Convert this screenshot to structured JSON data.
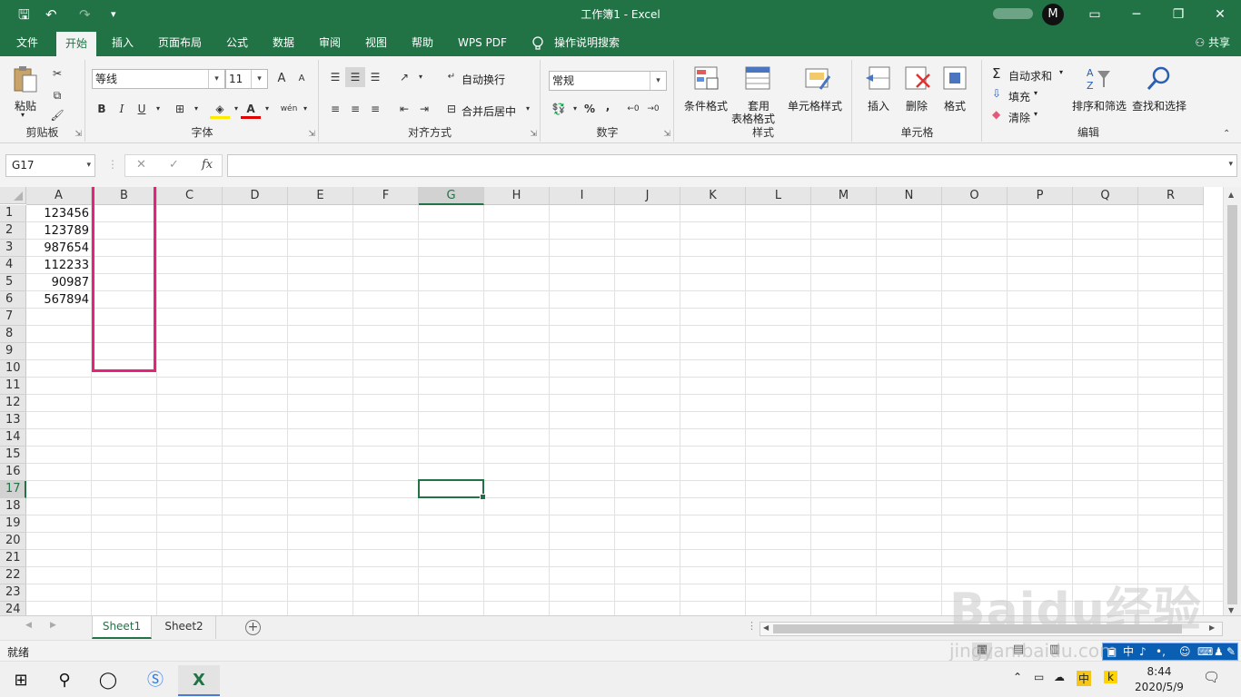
{
  "titlebar": {
    "title": "工作簿1  -  Excel",
    "avatar_initial": "M",
    "quick_access": {
      "save": "🖫",
      "undo": "↶",
      "redo": "↷",
      "customize": "▾"
    },
    "window_buttons": {
      "ribbon_display": "▭",
      "minimize": "─",
      "restore": "❐",
      "close": "✕"
    }
  },
  "tabs": [
    {
      "label": "文件"
    },
    {
      "label": "开始"
    },
    {
      "label": "插入"
    },
    {
      "label": "页面布局"
    },
    {
      "label": "公式"
    },
    {
      "label": "数据"
    },
    {
      "label": "审阅"
    },
    {
      "label": "视图"
    },
    {
      "label": "帮助"
    },
    {
      "label": "WPS PDF"
    },
    {
      "label": "操作说明搜索"
    }
  ],
  "share_label": "共享",
  "ribbon": {
    "clipboard": {
      "label": "剪贴板",
      "paste": "粘贴"
    },
    "font": {
      "label": "字体",
      "font_name": "等线",
      "font_size": "11",
      "bold": "B",
      "italic": "I",
      "underline": "U",
      "grow": "A",
      "shrink": "A",
      "color_letter": "A",
      "wen": "wén"
    },
    "alignment": {
      "label": "对齐方式",
      "wrap_text": "自动换行",
      "merge_center": "合并后居中"
    },
    "number": {
      "label": "数字",
      "format": "常规",
      "percent": "%",
      "comma": ","
    },
    "styles": {
      "label": "样式",
      "conditional": "条件格式",
      "table_format_1": "套用",
      "table_format_2": "表格格式",
      "cell_styles": "单元格样式"
    },
    "cells": {
      "label": "单元格",
      "insert": "插入",
      "delete": "删除",
      "format": "格式"
    },
    "editing": {
      "label": "编辑",
      "autosum": "自动求和",
      "fill": "填充",
      "clear": "清除",
      "sort_filter": "排序和筛选",
      "find_select": "查找和选择"
    }
  },
  "formula_bar": {
    "name_box": "G17",
    "cancel": "✕",
    "enter": "✓",
    "fx": "fx",
    "value": ""
  },
  "columns": [
    "A",
    "B",
    "C",
    "D",
    "E",
    "F",
    "G",
    "H",
    "I",
    "J",
    "K",
    "L",
    "M",
    "N",
    "O",
    "P",
    "Q",
    "R"
  ],
  "rows": [
    "1",
    "2",
    "3",
    "4",
    "5",
    "6",
    "7",
    "8",
    "9",
    "10",
    "11",
    "12",
    "13",
    "14",
    "15",
    "16",
    "17",
    "18",
    "19",
    "20",
    "21",
    "22",
    "23",
    "24"
  ],
  "column_a_values": [
    "123456",
    "123789",
    "987654",
    "112233",
    "90987",
    "567894"
  ],
  "selected_cell": "G17",
  "sheets": [
    {
      "label": "Sheet1",
      "active": true
    },
    {
      "label": "Sheet2",
      "active": false
    }
  ],
  "status": {
    "ready": "就绪"
  },
  "ime": {
    "zh": "中",
    "sym": "♪",
    "dot": "•,"
  },
  "watermark": {
    "main": "Baidu经验",
    "url": "jingyan.baidu.com"
  },
  "taskbar": {
    "time": "8:44",
    "date": "2020/5/9",
    "ime_cn": "中",
    "k": "k"
  },
  "colors": {
    "accent": "#217346",
    "highlight": "#e8217b"
  }
}
